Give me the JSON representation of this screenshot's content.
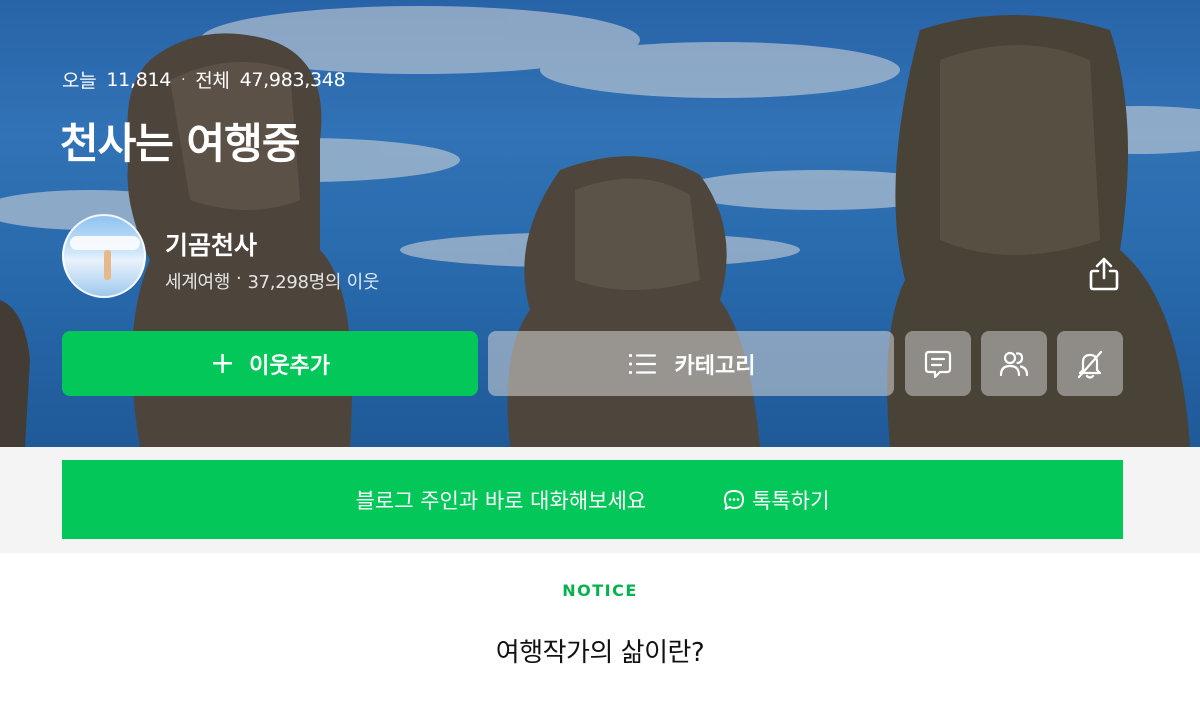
{
  "header": {
    "today_label": "오늘",
    "today_count": "11,814",
    "separator": "·",
    "total_label": "전체",
    "total_count": "47,983,348",
    "blog_title": "천사는 여행중"
  },
  "profile": {
    "nickname": "기곰천사",
    "category": "세계여행",
    "separator": "·",
    "neighbors": "37,298명의 이웃"
  },
  "actions": {
    "add_neighbor_label": "이웃추가",
    "category_label": "카테고리",
    "icons": [
      "share-icon",
      "plus-icon",
      "list-icon",
      "guestbook-icon",
      "neighbors-icon",
      "notification-off-icon"
    ]
  },
  "talk": {
    "message": "블로그 주인과 바로 대화해보세요",
    "button_label": "톡톡하기",
    "icon": "chat-bubble-icon"
  },
  "notice": {
    "label": "NOTICE",
    "title": "여행작가의 삶이란?"
  },
  "colors": {
    "accent_green": "#04c75a",
    "notice_green": "#04b14f",
    "band_gray": "#f4f4f4"
  }
}
